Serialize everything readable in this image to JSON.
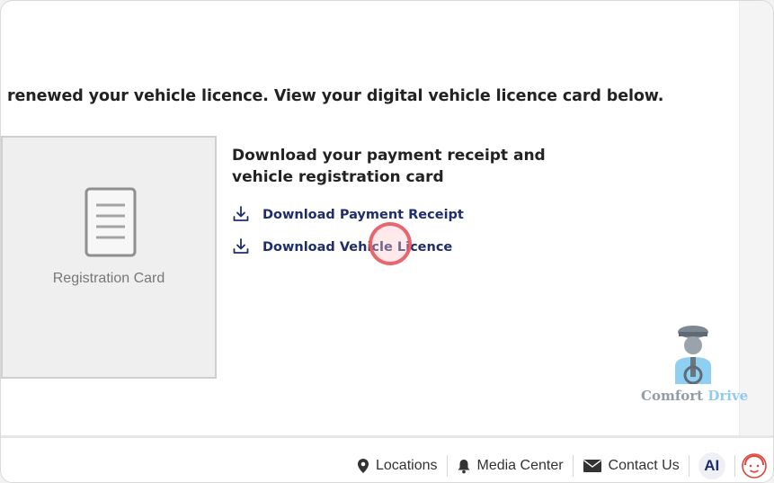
{
  "page": {
    "headline": "renewed your vehicle licence. View your digital vehicle licence card below."
  },
  "registration_card": {
    "label": "Registration Card",
    "icon": "document-icon"
  },
  "downloads": {
    "title": "Download your payment receipt and vehicle registration card",
    "links": [
      {
        "label": "Download Payment Receipt",
        "icon": "download-icon"
      },
      {
        "label": "Download Vehicle Licence",
        "icon": "download-icon"
      }
    ]
  },
  "chat_widget": {
    "brand_word_1": "Comfort",
    "brand_word_2": "Drive",
    "icon": "driver-avatar-icon"
  },
  "footer": {
    "items": [
      {
        "label": "Locations",
        "icon": "location-pin-icon"
      },
      {
        "label": "Media Center",
        "icon": "bell-icon"
      },
      {
        "label": "Contact Us",
        "icon": "envelope-icon"
      }
    ],
    "ai_label": "AI",
    "support_icon": "support-agent-icon"
  },
  "colors": {
    "link": "#1e2d6b",
    "click_marker": "#e45460",
    "brand_accent": "#7ec3ea"
  }
}
